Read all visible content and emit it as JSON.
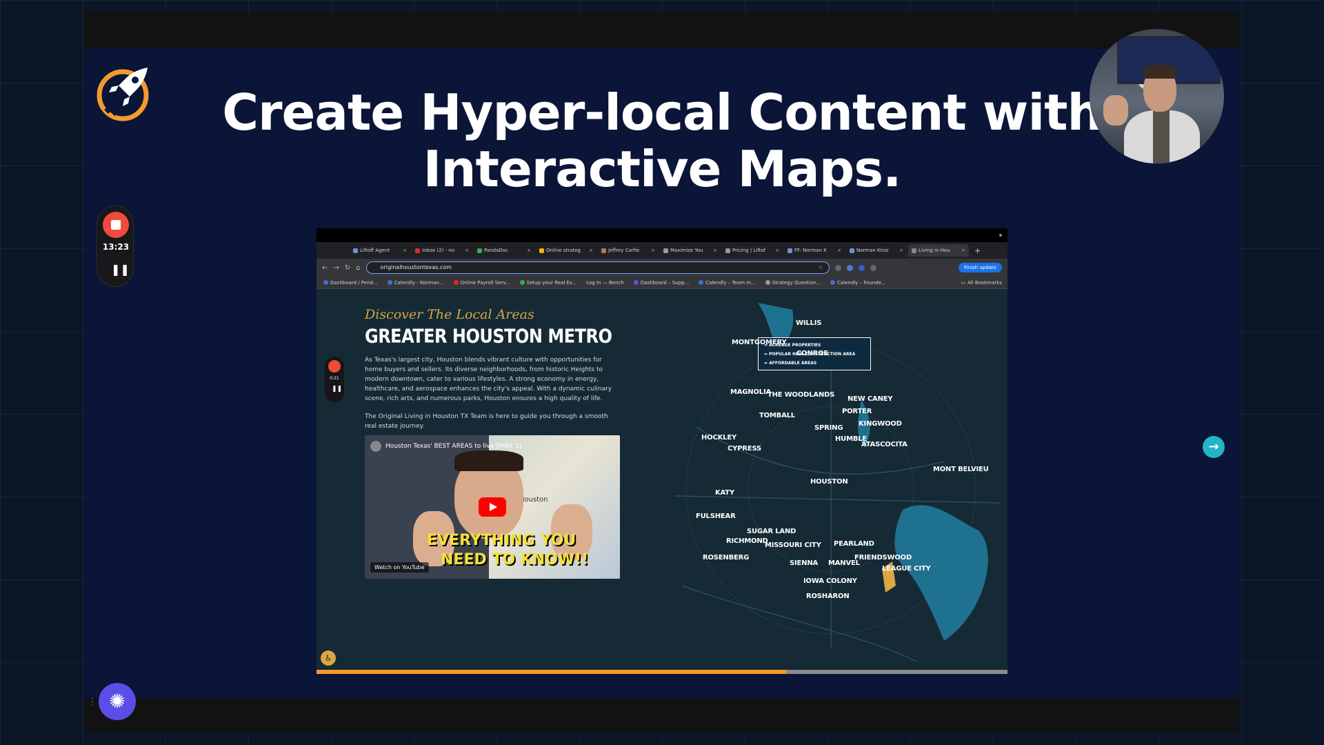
{
  "slide": {
    "headline_line1": "Create Hyper-local Content with",
    "headline_line2": "Interactive Maps."
  },
  "recorder": {
    "time": "13:23"
  },
  "browser": {
    "tabs": [
      "Liftoff Agent",
      "Inbox (2) - no",
      "PandaDoc",
      "Online strateg",
      "Jeffrey Corfie",
      "Maximize You",
      "Pricing | Liftof",
      "FF: Norman K",
      "Norman Kinsi",
      "Living in Hou"
    ],
    "url": "originalhoustontexas.com",
    "finish_update": "Finish update",
    "bookmarks": [
      "Dashboard / Pend...",
      "Calendly - Norman...",
      "Online Payroll Serv...",
      "Setup your Real Es...",
      "Log In — Bench",
      "Dashboard – Supp...",
      "Calendly – Team m...",
      "Strategy Question...",
      "Calendly – Founde..."
    ],
    "all_bookmarks": "All Bookmarks"
  },
  "page": {
    "kicker": "Discover The Local Areas",
    "title": "GREATER HOUSTON METRO",
    "para1": "As Texas's largest city, Houston blends vibrant culture with opportunities for home buyers and sellers. Its diverse neighborhoods, from historic Heights to modern downtown, cater to various lifestyles. A strong economy in energy, healthcare, and aerospace enhances the city's appeal. With a dynamic culinary scene, rich arts, and numerous parks, Houston ensures a high quality of life.",
    "para2": "The Original Living in Houston TX Team is here to guide you through a smooth real estate journey.",
    "inner_time": "0:21",
    "video": {
      "title": "Houston Texas' BEST AREAS to live [PART 1]",
      "caption1": "EVERYTHING YOU",
      "caption2": "NEED TO KNOW!!",
      "map_label": "Houston",
      "watch_on": "Watch on YouTube"
    },
    "legend": [
      "= ACREAGE PROPERTIES",
      "= POPULAR NEW CONSTRUCTION AREA",
      "= AFFORDABLE AREAS"
    ],
    "cities": [
      "WILLIS",
      "MONTGOMERY",
      "CONROE",
      "MAGNOLIA",
      "THE WOODLANDS",
      "NEW CANEY",
      "PORTER",
      "TOMBALL",
      "KINGWOOD",
      "SPRING",
      "HOCKLEY",
      "HUMBLE",
      "ATASCOCITA",
      "CYPRESS",
      "MONT BELVIEU",
      "KATY",
      "HOUSTON",
      "FULSHEAR",
      "SUGAR LAND",
      "RICHMOND",
      "MISSOURI CITY",
      "PEARLAND",
      "ROSENBERG",
      "FRIENDSWOOD",
      "SIENNA",
      "MANVEL",
      "LEAGUE CITY",
      "IOWA COLONY",
      "ROSHARON"
    ]
  },
  "colors": {
    "slide_bg": "#0a1538",
    "accent_orange": "#f29b2c",
    "record_red": "#ef4b3c",
    "fab_purple": "#5b4ee6",
    "kicker_gold": "#d9a743"
  },
  "icons": [
    "rocket-logo-icon",
    "stop-icon",
    "pause-icon",
    "sparkle-icon",
    "arrow-right-icon",
    "star-icon",
    "youtube-play-icon",
    "accessibility-icon"
  ]
}
